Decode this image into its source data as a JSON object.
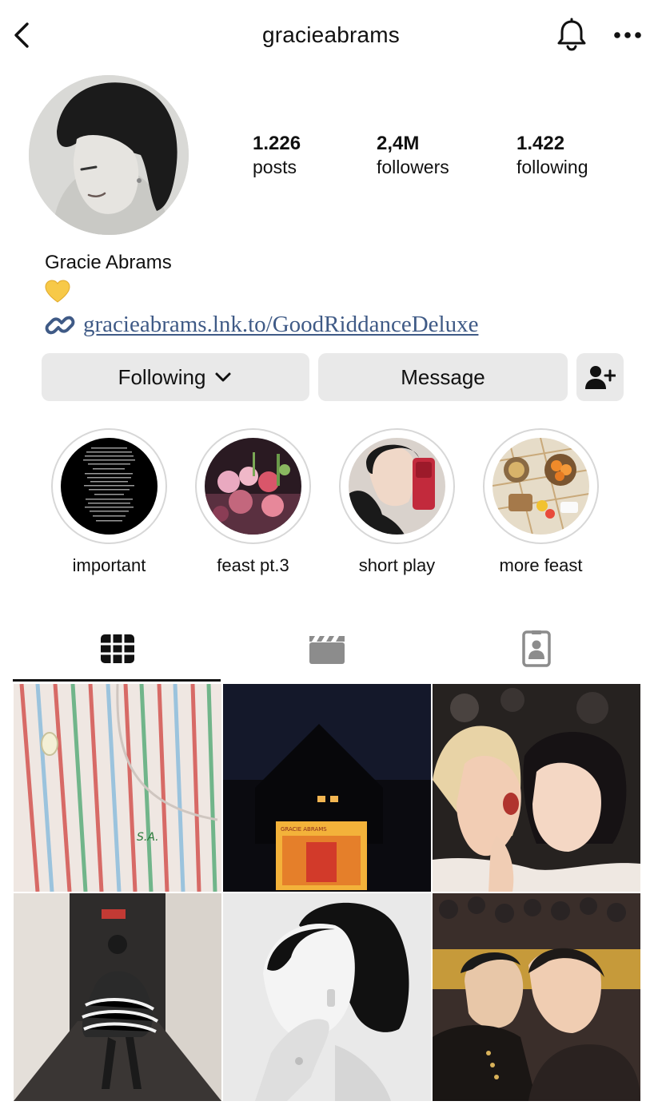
{
  "header": {
    "username": "gracieabrams",
    "back_icon": "chevron-left-icon",
    "notifications_icon": "bell-icon",
    "more_icon": "more-horizontal-icon"
  },
  "profile": {
    "full_name": "Gracie Abrams",
    "bio_emoji": "yellow-heart-icon",
    "link_text": "gracieabrams.lnk.to/GoodRiddanceDeluxe",
    "stats": {
      "posts": {
        "value": "1.226",
        "label": "posts"
      },
      "followers": {
        "value": "2,4M",
        "label": "followers"
      },
      "following": {
        "value": "1.422",
        "label": "following"
      }
    }
  },
  "actions": {
    "following_label": "Following",
    "message_label": "Message",
    "add_user_icon": "person-add-icon"
  },
  "highlights": [
    {
      "label": "important"
    },
    {
      "label": "feast pt.3"
    },
    {
      "label": "short play"
    },
    {
      "label": "more feast"
    }
  ],
  "tabs": {
    "active": "posts",
    "icons": [
      "grid-icon",
      "reels-clapper-icon",
      "tagged-person-icon"
    ]
  },
  "colors": {
    "link": "#3f5a86",
    "button_bg": "#e9e9e9",
    "heart": "#f7c948"
  }
}
